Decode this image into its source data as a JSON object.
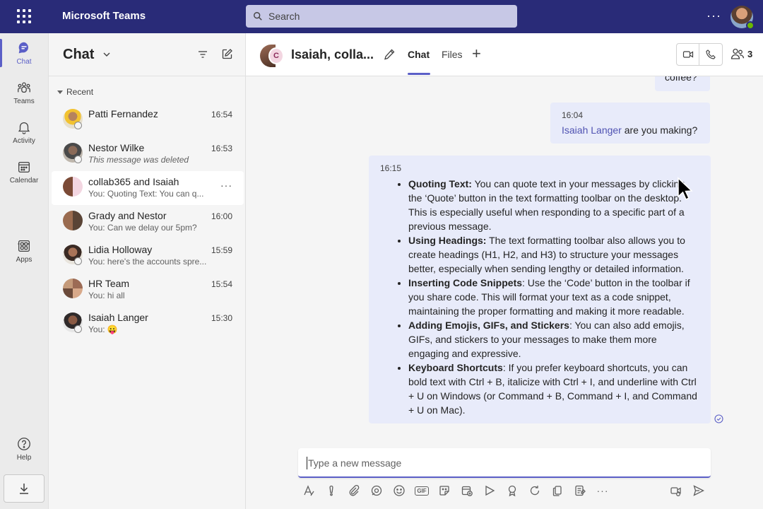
{
  "app": {
    "title": "Microsoft Teams"
  },
  "search": {
    "placeholder": "Search"
  },
  "titlebar": {
    "more": "···"
  },
  "rail": {
    "items": [
      {
        "label": "Chat",
        "icon": "chat-icon",
        "active": true
      },
      {
        "label": "Teams",
        "icon": "teams-icon"
      },
      {
        "label": "Activity",
        "icon": "bell-icon"
      },
      {
        "label": "Calendar",
        "icon": "calendar-icon"
      },
      {
        "label": "Apps",
        "icon": "apps-icon"
      },
      {
        "label": "Help",
        "icon": "help-icon"
      }
    ],
    "more": "···"
  },
  "chatlist": {
    "title": "Chat",
    "section": "Recent",
    "chats": [
      {
        "name": "Patti Fernandez",
        "time": "16:54",
        "preview": ""
      },
      {
        "name": "Nestor Wilke",
        "time": "16:53",
        "preview": "This message was deleted"
      },
      {
        "name": "collab365 and Isaiah",
        "time": "",
        "preview": "You: Quoting Text: You can q...",
        "more": "···"
      },
      {
        "name": "Grady and Nestor",
        "time": "16:00",
        "preview": "You: Can we delay our 5pm?"
      },
      {
        "name": "Lidia Holloway",
        "time": "15:59",
        "preview": "You: here's the accounts spre..."
      },
      {
        "name": "HR Team",
        "time": "15:54",
        "preview": "You: hi all"
      },
      {
        "name": "Isaiah Langer",
        "time": "15:30",
        "preview": "You: 😛"
      }
    ]
  },
  "conversation": {
    "title": "Isaiah, colla...",
    "avatar_initial": "C",
    "tabs": {
      "chat": "Chat",
      "files": "Files",
      "add": "+"
    },
    "participants": "3",
    "messages": {
      "partial": "coffee?",
      "second": {
        "time": "16:04",
        "mention": "Isaiah Langer",
        "text": " are you making?"
      },
      "third": {
        "time": "16:15",
        "bullets": [
          {
            "bold": "Quoting Text:",
            "text": " You can quote text in your messages by clicking the ‘Quote’ button in the text formatting toolbar on the desktop. This is especially useful when responding to a specific part of a previous message."
          },
          {
            "bold": "Using Headings:",
            "text": " The text formatting toolbar also allows you to create headings (H1, H2, and H3) to structure your messages better, especially when sending lengthy or detailed information."
          },
          {
            "bold": "Inserting Code Snippets",
            "text": ": Use the ‘Code’ button in the toolbar if you share code. This will format your text as a code snippet, maintaining the proper formatting and making it more readable."
          },
          {
            "bold": "Adding Emojis, GIFs, and Stickers",
            "text": ": You can also add emojis, GIFs, and stickers to your messages to make them more engaging and expressive."
          },
          {
            "bold": "Keyboard Shortcuts",
            "text": ": If you prefer keyboard shortcuts, you can bold text with Ctrl + B, italicize with Ctrl + I, and underline with Ctrl + U on Windows (or Command + B, Command + I, and Command + U on Mac)."
          }
        ]
      }
    }
  },
  "composer": {
    "placeholder": "Type a new message",
    "gif": "GIF",
    "more": "···"
  },
  "colors": {
    "titlebar": "#292b78",
    "accent": "#5b5fc7",
    "bubble": "#e8ebfa"
  }
}
